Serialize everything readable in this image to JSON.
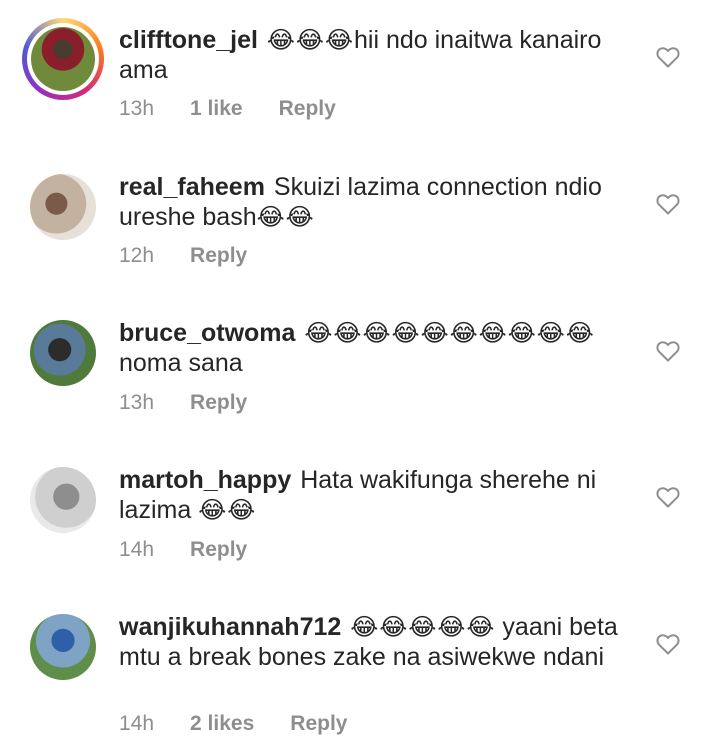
{
  "comments": [
    {
      "username": "clifftone_jel",
      "emoji": "😂😂😂",
      "text_after_emoji": "hii ndo inaitwa kanairo ama",
      "time": "13h",
      "likes": "1 like",
      "reply": "Reply",
      "avatar_icon": "user-avatar-story-ring"
    },
    {
      "username": "real_faheem",
      "text": "Skuizi lazima connection ndio ureshe bash",
      "emoji": "😂😂",
      "time": "12h",
      "reply": "Reply",
      "avatar_icon": "user-avatar"
    },
    {
      "username": "bruce_otwoma",
      "emoji": "😂😂😂😂😂😂😂😂😂😂",
      "text_after_emoji": "noma sana",
      "time": "13h",
      "reply": "Reply",
      "avatar_icon": "user-avatar"
    },
    {
      "username": "martoh_happy",
      "text": "Hata wakifunga sherehe ni lazima",
      "emoji": "😂😂",
      "time": "14h",
      "reply": "Reply",
      "avatar_icon": "user-avatar"
    },
    {
      "username": "wanjikuhannah712",
      "emoji": "😂😂😂😂😂",
      "text_after_emoji": "yaani beta mtu a break bones zake na asiwekwe ndani",
      "time": "14h",
      "likes": "2 likes",
      "reply": "Reply",
      "avatar_icon": "user-avatar"
    }
  ],
  "icons": {
    "like": "heart-outline-icon"
  },
  "colors": {
    "text": "#262626",
    "meta": "#8e8e8e",
    "background": "#ffffff"
  }
}
